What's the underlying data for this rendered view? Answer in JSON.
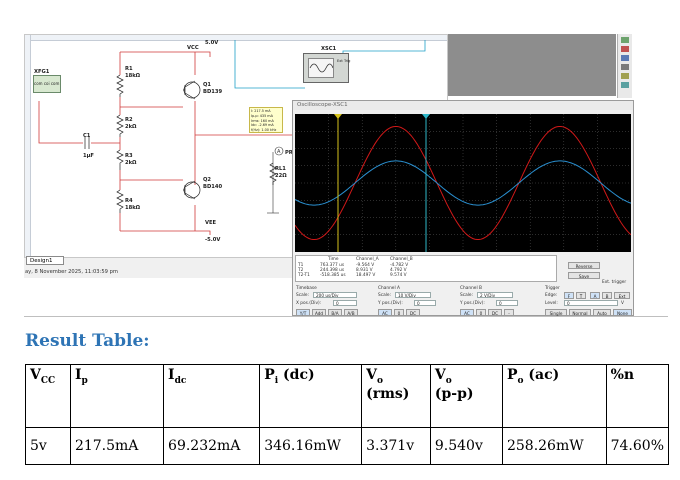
{
  "schematic": {
    "vcc_label": "VCC",
    "vcc_value": "5.0V",
    "vee_label": "VEE",
    "vee_value": "-5.0V",
    "xfg_label": "XFG1",
    "xfg_terminals": "com coi com",
    "xsc_label": "XSC1",
    "xsc_terms": "Ext Trig",
    "resistors": [
      {
        "name": "R1",
        "value": "18kΩ"
      },
      {
        "name": "R2",
        "value": "2kΩ"
      },
      {
        "name": "R3",
        "value": "2kΩ"
      },
      {
        "name": "R4",
        "value": "18kΩ"
      },
      {
        "name": "RL1",
        "value": "22Ω"
      }
    ],
    "capacitor": {
      "name": "C1",
      "value": "1µF"
    },
    "transistors": [
      {
        "name": "Q1",
        "model": "BD139"
      },
      {
        "name": "Q2",
        "model": "BD140"
      }
    ],
    "probe_label": "PR",
    "probe_readout": [
      "I: 217.5 mA",
      "Ip-p: 435 mA",
      "Irms: 160 mA",
      "Idc: -2.69 mA",
      "f(Hz): 1.00 kHz"
    ],
    "design_tab": "Design1",
    "status_text": "ay, 8 November 2025, 11:03:59 pm"
  },
  "oscilloscope": {
    "title": "Oscilloscope-XSC1",
    "colors": {
      "channel_a": "#d01818",
      "channel_b": "#2a8fcf",
      "cursor1": "#d6c21c",
      "cursor2": "#2fb7c9",
      "grid": "#5a5a5a"
    },
    "readout": {
      "headers": [
        "Time",
        "Channel_A",
        "Channel_B"
      ],
      "rows": [
        {
          "label": "T1",
          "time": "763.377 us",
          "a": "-9.564 V",
          "b": "-4.782 V"
        },
        {
          "label": "T2",
          "time": "244.398 us",
          "a": "8.931 V",
          "b": "4.792 V"
        },
        {
          "label": "T2-T1",
          "time": "-518.385 us",
          "a": "18.497 V",
          "b": "9.574 V"
        }
      ]
    },
    "buttons": {
      "reverse": "Reverse",
      "save": "Save",
      "ext_trigger": "Ext. trigger"
    },
    "timebase": {
      "label": "Timebase",
      "scale_label": "Scale:",
      "scale": "200 us/Div",
      "xpos_label": "X pos.(Div):",
      "xpos": "0",
      "modes": [
        "Y/T",
        "Add",
        "B/A",
        "A/B"
      ]
    },
    "channel_a": {
      "label": "Channel A",
      "scale_label": "Scale:",
      "scale": "10 V/Div",
      "ypos_label": "Y pos.(Div):",
      "ypos": "0",
      "modes": [
        "AC",
        "0",
        "DC"
      ]
    },
    "channel_b": {
      "label": "Channel B",
      "scale_label": "Scale:",
      "scale": "2 V/Div",
      "ypos_label": "Y pos.(Div):",
      "ypos": "0",
      "modes": [
        "AC",
        "0",
        "DC",
        "-"
      ]
    },
    "trigger": {
      "label": "Trigger",
      "edge_label": "Edge:",
      "edge_buttons": [
        "F",
        "Ť",
        "A",
        "B",
        "Ext"
      ],
      "level_label": "Level:",
      "level": "0",
      "level_unit": "V",
      "modes": [
        "Single",
        "Normal",
        "Auto",
        "None"
      ]
    }
  },
  "result": {
    "title": "Result Table:",
    "headers": [
      {
        "main": "V",
        "sub": "CC",
        "second": ""
      },
      {
        "main": "I",
        "sub": "p",
        "second": ""
      },
      {
        "main": "I",
        "sub": "dc",
        "second": ""
      },
      {
        "main": "P",
        "sub": "i",
        "tail": " (dc)",
        "second": ""
      },
      {
        "main": "V",
        "sub": "o",
        "second": "(rms)"
      },
      {
        "main": "V",
        "sub": "o",
        "second": "(p-p)"
      },
      {
        "main": "P",
        "sub": "o",
        "tail": " (ac)",
        "second": ""
      },
      {
        "main": "%n",
        "sub": "",
        "second": ""
      }
    ],
    "row": [
      "5v",
      "217.5mA",
      "69.232mA",
      "346.16mW",
      "3.371v",
      "9.540v",
      "258.26mW",
      "74.60%"
    ]
  }
}
